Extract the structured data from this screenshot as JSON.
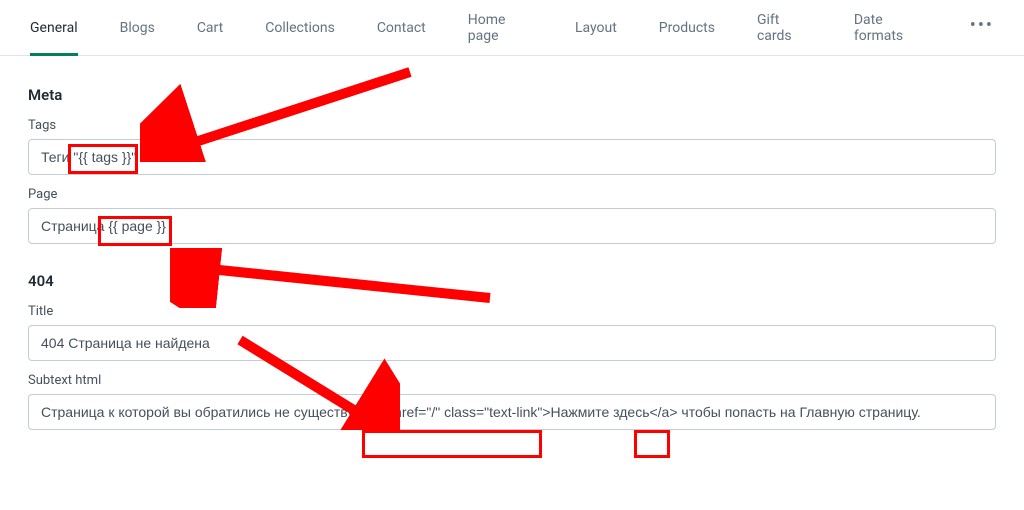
{
  "tabs": {
    "items": [
      "General",
      "Blogs",
      "Cart",
      "Collections",
      "Contact",
      "Home page",
      "Layout",
      "Products",
      "Gift cards",
      "Date formats"
    ],
    "active_index": 0
  },
  "sections": {
    "meta": {
      "heading": "Meta",
      "tags_label": "Tags",
      "tags_value": "Теги \"{{ tags }}\"",
      "page_label": "Page",
      "page_value": "Страница {{ page }}"
    },
    "not_found": {
      "heading": "404",
      "title_label": "Title",
      "title_value": "404 Страница не найдена",
      "subtext_label": "Subtext html",
      "subtext_value": "Страница к которой вы обратились не существует. <a href=\"/\" class=\"text-link\">Нажмите здесь</a> чтобы попасть на Главную страницу."
    }
  },
  "annotation_color": "#ff0000"
}
